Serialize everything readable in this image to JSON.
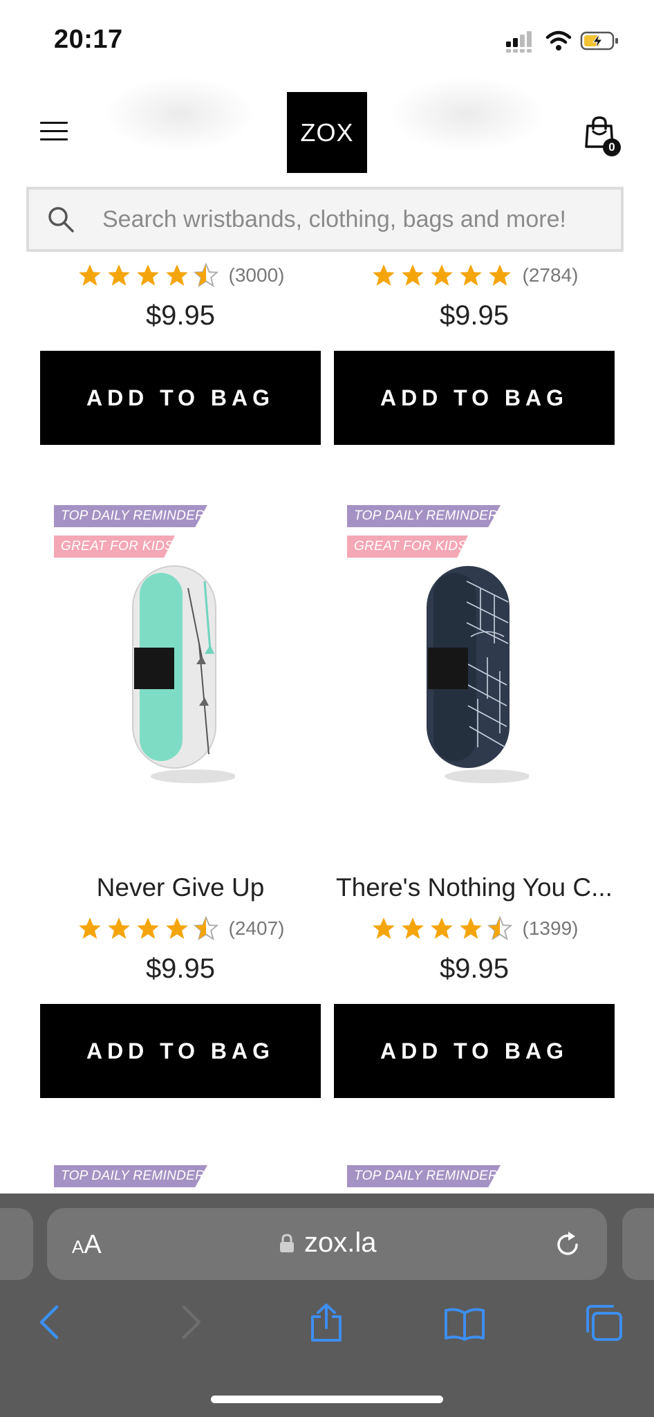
{
  "status_bar": {
    "time": "20:17"
  },
  "header": {
    "logo": "ZOX",
    "cart_count": "0"
  },
  "search": {
    "placeholder": "Search wristbands, clothing, bags and more!"
  },
  "colors": {
    "star": "#f5a50c",
    "tag_purple": "#a592c4",
    "tag_pink": "#f4a7b5",
    "button_bg": "#000000"
  },
  "products_top": [
    {
      "rating": 4.5,
      "review_count": "(3000)",
      "price": "$9.95",
      "button": "ADD TO BAG"
    },
    {
      "rating": 5,
      "review_count": "(2784)",
      "price": "$9.95",
      "button": "ADD TO BAG"
    }
  ],
  "products": [
    {
      "tags": [
        "TOP DAILY REMINDER",
        "GREAT FOR KIDS"
      ],
      "name": "Never Give Up",
      "rating": 4.5,
      "review_count": "(2407)",
      "price": "$9.95",
      "button": "ADD TO BAG"
    },
    {
      "tags": [
        "TOP DAILY REMINDER",
        "GREAT FOR KIDS"
      ],
      "name": "There's Nothing You C...",
      "rating": 4.5,
      "review_count": "(1399)",
      "price": "$9.95",
      "button": "ADD TO BAG"
    }
  ],
  "products_next": [
    {
      "tags": [
        "TOP DAILY REMINDER"
      ]
    },
    {
      "tags": [
        "TOP DAILY REMINDER"
      ]
    }
  ],
  "browser": {
    "aa_label_small": "A",
    "aa_label_large": "A",
    "url": "zox.la"
  },
  "icons": [
    "menu-icon",
    "shopping-bag-icon",
    "search-icon",
    "star-icon",
    "lock-icon",
    "reload-icon",
    "back-icon",
    "forward-icon",
    "share-icon",
    "bookmarks-icon",
    "tabs-icon"
  ]
}
